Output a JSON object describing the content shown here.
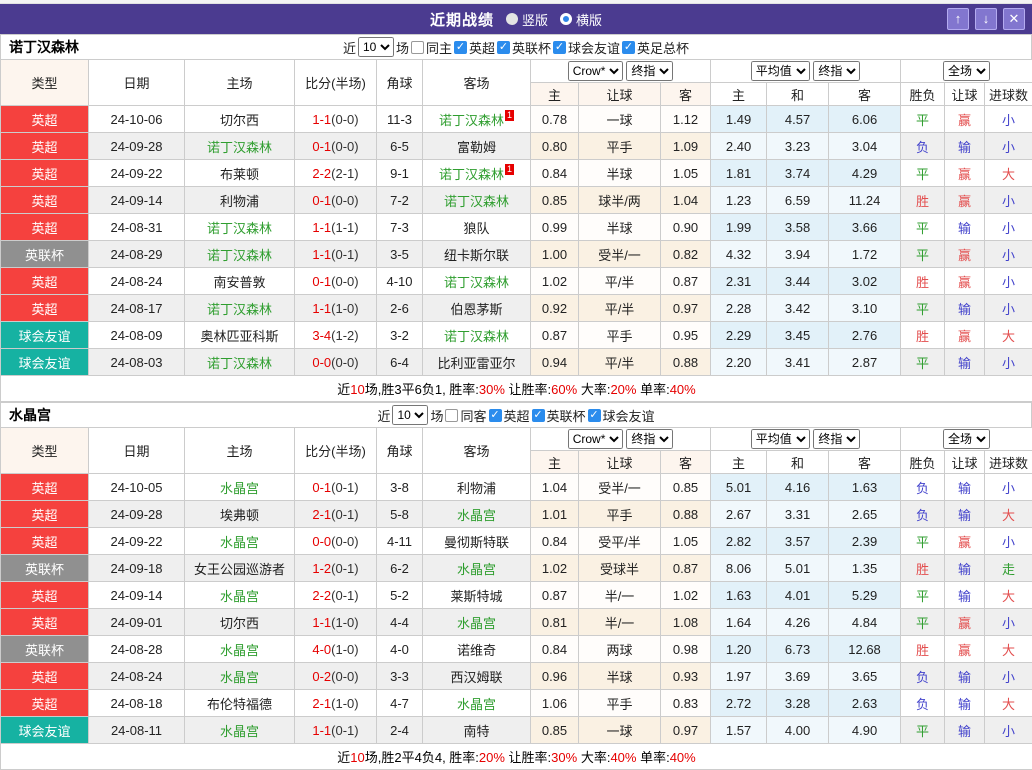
{
  "titlebar": {
    "title": "近期战绩",
    "vertical_label": "竖版",
    "horizontal_label": "横版",
    "vertical_selected": false,
    "horizontal_selected": true,
    "buttons": [
      {
        "name": "scroll-up-button",
        "glyph": "↑"
      },
      {
        "name": "scroll-down-button",
        "glyph": "↓"
      },
      {
        "name": "close-button",
        "glyph": "✕"
      }
    ]
  },
  "colors": {
    "titlebar_purple": "#4b3b90",
    "league_red": "#f5413e",
    "league_gray": "#909090",
    "league_teal": "#16b2a2",
    "focus_team_green": "#2f9e2f",
    "score_red": "#e60000",
    "result_win_red": "#e34e4e",
    "result_draw_green": "#2f9e2f",
    "result_lose_blue": "#4343cc",
    "checkbox_blue": "#2b8ced"
  },
  "header_labels": {
    "type": "类型",
    "date": "日期",
    "home": "主场",
    "score": "比分(半场)",
    "corner": "角球",
    "away": "客场",
    "ah_home": "主",
    "ah_line": "让球",
    "ah_away": "客",
    "eu_home": "主",
    "eu_draw": "和",
    "eu_away": "客",
    "result_wdl": "胜负",
    "result_ah": "让球",
    "result_goals": "进球数",
    "selects": {
      "crow": "Crow*",
      "final1": "终指",
      "avg": "平均值",
      "final2": "终指",
      "fullmatch": "全场"
    }
  },
  "filter_labels": {
    "near": "近",
    "games": "场",
    "check_glyph": "✓"
  },
  "tables": [
    {
      "team": "诺丁汉森林",
      "filter": {
        "count": "10",
        "same": "同主",
        "same_checked": false,
        "leagues": [
          "英超",
          "英联杯",
          "球会友谊",
          "英足总杯"
        ]
      },
      "rows": [
        {
          "lg": "英超",
          "lc": "red",
          "d": "24-10-06",
          "h": "切尔西",
          "hf": false,
          "hs": "",
          "s": "1-1",
          "sh": "(0-0)",
          "c": "11-3",
          "a": "诺丁汉森林",
          "af": true,
          "as": "1",
          "ah": [
            "0.78",
            "一球",
            "1.12"
          ],
          "eu": [
            "1.49",
            "4.57",
            "6.06"
          ],
          "res": [
            [
              "平",
              "g"
            ],
            [
              "赢",
              "r"
            ],
            [
              "小",
              "b"
            ]
          ]
        },
        {
          "lg": "英超",
          "lc": "red",
          "d": "24-09-28",
          "h": "诺丁汉森林",
          "hf": true,
          "hs": "",
          "s": "0-1",
          "sh": "(0-0)",
          "c": "6-5",
          "a": "富勒姆",
          "af": false,
          "as": "",
          "ah": [
            "0.80",
            "平手",
            "1.09"
          ],
          "eu": [
            "2.40",
            "3.23",
            "3.04"
          ],
          "res": [
            [
              "负",
              "b"
            ],
            [
              "输",
              "b"
            ],
            [
              "小",
              "b"
            ]
          ]
        },
        {
          "lg": "英超",
          "lc": "red",
          "d": "24-09-22",
          "h": "布莱顿",
          "hf": false,
          "hs": "",
          "s": "2-2",
          "sh": "(2-1)",
          "c": "9-1",
          "a": "诺丁汉森林",
          "af": true,
          "as": "1",
          "ah": [
            "0.84",
            "半球",
            "1.05"
          ],
          "eu": [
            "1.81",
            "3.74",
            "4.29"
          ],
          "res": [
            [
              "平",
              "g"
            ],
            [
              "赢",
              "r"
            ],
            [
              "大",
              "r"
            ]
          ]
        },
        {
          "lg": "英超",
          "lc": "red",
          "d": "24-09-14",
          "h": "利物浦",
          "hf": false,
          "hs": "",
          "s": "0-1",
          "sh": "(0-0)",
          "c": "7-2",
          "a": "诺丁汉森林",
          "af": true,
          "as": "",
          "ah": [
            "0.85",
            "球半/两",
            "1.04"
          ],
          "eu": [
            "1.23",
            "6.59",
            "11.24"
          ],
          "res": [
            [
              "胜",
              "r"
            ],
            [
              "赢",
              "r"
            ],
            [
              "小",
              "b"
            ]
          ]
        },
        {
          "lg": "英超",
          "lc": "red",
          "d": "24-08-31",
          "h": "诺丁汉森林",
          "hf": true,
          "hs": "",
          "s": "1-1",
          "sh": "(1-1)",
          "c": "7-3",
          "a": "狼队",
          "af": false,
          "as": "",
          "ah": [
            "0.99",
            "半球",
            "0.90"
          ],
          "eu": [
            "1.99",
            "3.58",
            "3.66"
          ],
          "res": [
            [
              "平",
              "g"
            ],
            [
              "输",
              "b"
            ],
            [
              "小",
              "b"
            ]
          ]
        },
        {
          "lg": "英联杯",
          "lc": "gray",
          "d": "24-08-29",
          "h": "诺丁汉森林",
          "hf": true,
          "hs": "",
          "s": "1-1",
          "sh": "(0-1)",
          "c": "3-5",
          "a": "纽卡斯尔联",
          "af": false,
          "as": "",
          "ah": [
            "1.00",
            "受半/一",
            "0.82"
          ],
          "eu": [
            "4.32",
            "3.94",
            "1.72"
          ],
          "res": [
            [
              "平",
              "g"
            ],
            [
              "赢",
              "r"
            ],
            [
              "小",
              "b"
            ]
          ]
        },
        {
          "lg": "英超",
          "lc": "red",
          "d": "24-08-24",
          "h": "南安普敦",
          "hf": false,
          "hs": "",
          "s": "0-1",
          "sh": "(0-0)",
          "c": "4-10",
          "a": "诺丁汉森林",
          "af": true,
          "as": "",
          "ah": [
            "1.02",
            "平/半",
            "0.87"
          ],
          "eu": [
            "2.31",
            "3.44",
            "3.02"
          ],
          "res": [
            [
              "胜",
              "r"
            ],
            [
              "赢",
              "r"
            ],
            [
              "小",
              "b"
            ]
          ]
        },
        {
          "lg": "英超",
          "lc": "red",
          "d": "24-08-17",
          "h": "诺丁汉森林",
          "hf": true,
          "hs": "",
          "s": "1-1",
          "sh": "(1-0)",
          "c": "2-6",
          "a": "伯恩茅斯",
          "af": false,
          "as": "",
          "ah": [
            "0.92",
            "平/半",
            "0.97"
          ],
          "eu": [
            "2.28",
            "3.42",
            "3.10"
          ],
          "res": [
            [
              "平",
              "g"
            ],
            [
              "输",
              "b"
            ],
            [
              "小",
              "b"
            ]
          ]
        },
        {
          "lg": "球会友谊",
          "lc": "teal",
          "d": "24-08-09",
          "h": "奥林匹亚科斯",
          "hf": false,
          "hs": "",
          "s": "3-4",
          "sh": "(1-2)",
          "c": "3-2",
          "a": "诺丁汉森林",
          "af": true,
          "as": "",
          "ah": [
            "0.87",
            "平手",
            "0.95"
          ],
          "eu": [
            "2.29",
            "3.45",
            "2.76"
          ],
          "res": [
            [
              "胜",
              "r"
            ],
            [
              "赢",
              "r"
            ],
            [
              "大",
              "r"
            ]
          ]
        },
        {
          "lg": "球会友谊",
          "lc": "teal",
          "d": "24-08-03",
          "h": "诺丁汉森林",
          "hf": true,
          "hs": "",
          "s": "0-0",
          "sh": "(0-0)",
          "c": "6-4",
          "a": "比利亚雷亚尔",
          "af": false,
          "as": "",
          "ah": [
            "0.94",
            "平/半",
            "0.88"
          ],
          "eu": [
            "2.20",
            "3.41",
            "2.87"
          ],
          "res": [
            [
              "平",
              "g"
            ],
            [
              "输",
              "b"
            ],
            [
              "小",
              "b"
            ]
          ]
        }
      ],
      "summary": [
        {
          "text": "近",
          "red": false
        },
        {
          "text": "10",
          "red": true
        },
        {
          "text": "场,胜3平6负1, 胜率:",
          "red": false
        },
        {
          "text": "30%",
          "red": true
        },
        {
          "text": " 让胜率:",
          "red": false
        },
        {
          "text": "60%",
          "red": true
        },
        {
          "text": " 大率:",
          "red": false
        },
        {
          "text": "20%",
          "red": true
        },
        {
          "text": " 单率:",
          "red": false
        },
        {
          "text": "40%",
          "red": true
        }
      ]
    },
    {
      "team": "水晶宫",
      "filter": {
        "count": "10",
        "same": "同客",
        "same_checked": false,
        "leagues": [
          "英超",
          "英联杯",
          "球会友谊"
        ]
      },
      "rows": [
        {
          "lg": "英超",
          "lc": "red",
          "d": "24-10-05",
          "h": "水晶宫",
          "hf": true,
          "hs": "",
          "s": "0-1",
          "sh": "(0-1)",
          "c": "3-8",
          "a": "利物浦",
          "af": false,
          "as": "",
          "ah": [
            "1.04",
            "受半/一",
            "0.85"
          ],
          "eu": [
            "5.01",
            "4.16",
            "1.63"
          ],
          "res": [
            [
              "负",
              "b"
            ],
            [
              "输",
              "b"
            ],
            [
              "小",
              "b"
            ]
          ]
        },
        {
          "lg": "英超",
          "lc": "red",
          "d": "24-09-28",
          "h": "埃弗顿",
          "hf": false,
          "hs": "",
          "s": "2-1",
          "sh": "(0-1)",
          "c": "5-8",
          "a": "水晶宫",
          "af": true,
          "as": "",
          "ah": [
            "1.01",
            "平手",
            "0.88"
          ],
          "eu": [
            "2.67",
            "3.31",
            "2.65"
          ],
          "res": [
            [
              "负",
              "b"
            ],
            [
              "输",
              "b"
            ],
            [
              "大",
              "r"
            ]
          ]
        },
        {
          "lg": "英超",
          "lc": "red",
          "d": "24-09-22",
          "h": "水晶宫",
          "hf": true,
          "hs": "",
          "s": "0-0",
          "sh": "(0-0)",
          "c": "4-11",
          "a": "曼彻斯特联",
          "af": false,
          "as": "",
          "ah": [
            "0.84",
            "受平/半",
            "1.05"
          ],
          "eu": [
            "2.82",
            "3.57",
            "2.39"
          ],
          "res": [
            [
              "平",
              "g"
            ],
            [
              "赢",
              "r"
            ],
            [
              "小",
              "b"
            ]
          ]
        },
        {
          "lg": "英联杯",
          "lc": "gray",
          "d": "24-09-18",
          "h": "女王公园巡游者",
          "hf": false,
          "hs": "",
          "s": "1-2",
          "sh": "(0-1)",
          "c": "6-2",
          "a": "水晶宫",
          "af": true,
          "as": "",
          "ah": [
            "1.02",
            "受球半",
            "0.87"
          ],
          "eu": [
            "8.06",
            "5.01",
            "1.35"
          ],
          "res": [
            [
              "胜",
              "r"
            ],
            [
              "输",
              "b"
            ],
            [
              "走",
              "g"
            ]
          ]
        },
        {
          "lg": "英超",
          "lc": "red",
          "d": "24-09-14",
          "h": "水晶宫",
          "hf": true,
          "hs": "",
          "s": "2-2",
          "sh": "(0-1)",
          "c": "5-2",
          "a": "莱斯特城",
          "af": false,
          "as": "",
          "ah": [
            "0.87",
            "半/一",
            "1.02"
          ],
          "eu": [
            "1.63",
            "4.01",
            "5.29"
          ],
          "res": [
            [
              "平",
              "g"
            ],
            [
              "输",
              "b"
            ],
            [
              "大",
              "r"
            ]
          ]
        },
        {
          "lg": "英超",
          "lc": "red",
          "d": "24-09-01",
          "h": "切尔西",
          "hf": false,
          "hs": "",
          "s": "1-1",
          "sh": "(1-0)",
          "c": "4-4",
          "a": "水晶宫",
          "af": true,
          "as": "",
          "ah": [
            "0.81",
            "半/一",
            "1.08"
          ],
          "eu": [
            "1.64",
            "4.26",
            "4.84"
          ],
          "res": [
            [
              "平",
              "g"
            ],
            [
              "赢",
              "r"
            ],
            [
              "小",
              "b"
            ]
          ]
        },
        {
          "lg": "英联杯",
          "lc": "gray",
          "d": "24-08-28",
          "h": "水晶宫",
          "hf": true,
          "hs": "",
          "s": "4-0",
          "sh": "(1-0)",
          "c": "4-0",
          "a": "诺维奇",
          "af": false,
          "as": "",
          "ah": [
            "0.84",
            "两球",
            "0.98"
          ],
          "eu": [
            "1.20",
            "6.73",
            "12.68"
          ],
          "res": [
            [
              "胜",
              "r"
            ],
            [
              "赢",
              "r"
            ],
            [
              "大",
              "r"
            ]
          ]
        },
        {
          "lg": "英超",
          "lc": "red",
          "d": "24-08-24",
          "h": "水晶宫",
          "hf": true,
          "hs": "",
          "s": "0-2",
          "sh": "(0-0)",
          "c": "3-3",
          "a": "西汉姆联",
          "af": false,
          "as": "",
          "ah": [
            "0.96",
            "半球",
            "0.93"
          ],
          "eu": [
            "1.97",
            "3.69",
            "3.65"
          ],
          "res": [
            [
              "负",
              "b"
            ],
            [
              "输",
              "b"
            ],
            [
              "小",
              "b"
            ]
          ]
        },
        {
          "lg": "英超",
          "lc": "red",
          "d": "24-08-18",
          "h": "布伦特福德",
          "hf": false,
          "hs": "",
          "s": "2-1",
          "sh": "(1-0)",
          "c": "4-7",
          "a": "水晶宫",
          "af": true,
          "as": "",
          "ah": [
            "1.06",
            "平手",
            "0.83"
          ],
          "eu": [
            "2.72",
            "3.28",
            "2.63"
          ],
          "res": [
            [
              "负",
              "b"
            ],
            [
              "输",
              "b"
            ],
            [
              "大",
              "r"
            ]
          ]
        },
        {
          "lg": "球会友谊",
          "lc": "teal",
          "d": "24-08-11",
          "h": "水晶宫",
          "hf": true,
          "hs": "",
          "s": "1-1",
          "sh": "(0-1)",
          "c": "2-4",
          "a": "南特",
          "af": false,
          "as": "",
          "ah": [
            "0.85",
            "一球",
            "0.97"
          ],
          "eu": [
            "1.57",
            "4.00",
            "4.90"
          ],
          "res": [
            [
              "平",
              "g"
            ],
            [
              "输",
              "b"
            ],
            [
              "小",
              "b"
            ]
          ]
        }
      ],
      "summary": [
        {
          "text": "近",
          "red": false
        },
        {
          "text": "10",
          "red": true
        },
        {
          "text": "场,胜2平4负4, 胜率:",
          "red": false
        },
        {
          "text": "20%",
          "red": true
        },
        {
          "text": " 让胜率:",
          "red": false
        },
        {
          "text": "30%",
          "red": true
        },
        {
          "text": " 大率:",
          "red": false
        },
        {
          "text": "40%",
          "red": true
        },
        {
          "text": " 单率:",
          "red": false
        },
        {
          "text": "40%",
          "red": true
        }
      ]
    }
  ]
}
